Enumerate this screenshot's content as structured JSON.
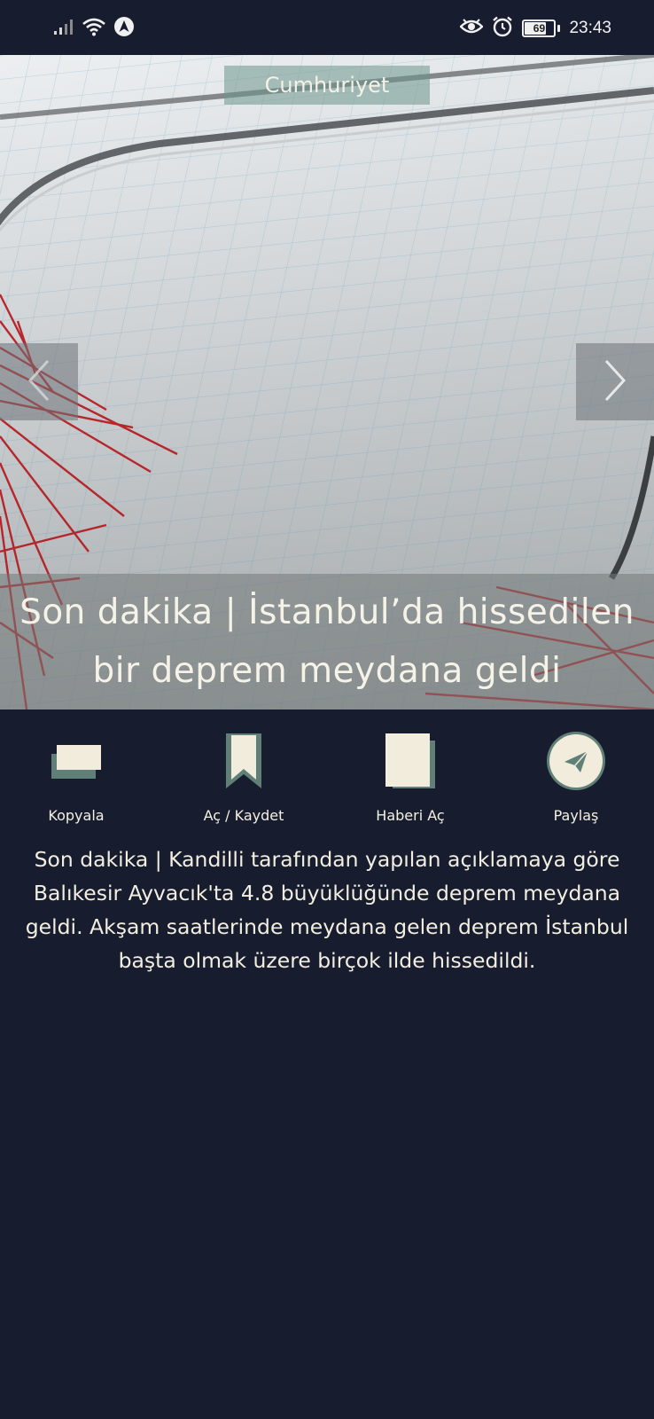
{
  "status_bar": {
    "battery_level": "69",
    "time": "23:43",
    "icons": [
      "signal-icon",
      "wifi-icon",
      "navigation-icon",
      "eye-icon",
      "alarm-icon",
      "battery-icon"
    ]
  },
  "hero": {
    "source": "Cumhuriyet",
    "headline": "Son dakika | İstanbul’da hissedilen bir deprem meydana geldi",
    "prev_icon": "chevron-left-icon",
    "next_icon": "chevron-right-icon"
  },
  "actions": [
    {
      "label": "Kopyala",
      "icon": "copy-icon"
    },
    {
      "label": "Aç / Kaydet",
      "icon": "bookmark-icon"
    },
    {
      "label": "Haberi Aç",
      "icon": "document-icon"
    },
    {
      "label": "Paylaş",
      "icon": "send-icon"
    }
  ],
  "article": {
    "summary": "Son dakika | Kandilli tarafından yapılan açıklamaya göre Balıkesir Ayvacık'ta 4.8 büyüklüğünde deprem meydana geldi. Akşam saatlerinde meydana gelen deprem İstanbul başta olmak üzere birçok ilde hissedildi."
  },
  "colors": {
    "background": "#181c2f",
    "cream": "#f1ecdc",
    "teal": "#5f7f77"
  }
}
